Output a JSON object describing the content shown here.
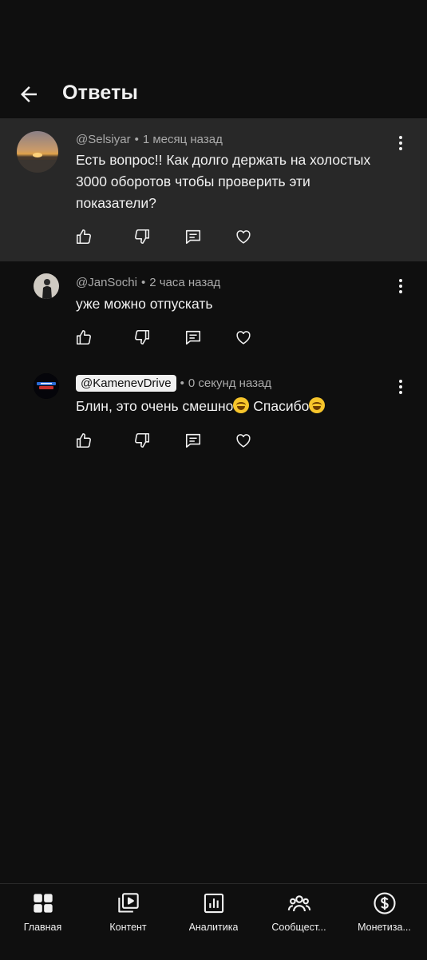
{
  "header": {
    "title": "Ответы"
  },
  "comments": [
    {
      "author": "@Selsiyar",
      "time": "1 месяц назад",
      "text_lines": [
        "Есть вопрос!! Как долго держать на холостых",
        "3000 оборотов чтобы проверить эти",
        "показатели?"
      ],
      "highlighted": true
    },
    {
      "author": "@JanSochi",
      "time": "2 часа назад",
      "text_lines": [
        "уже можно отпускать"
      ]
    },
    {
      "author": "@KamenevDrive",
      "time": "0 секунд назад",
      "text_before": "Блин, это очень смешно",
      "text_middle": " Спасибо",
      "emoji": "face-with-tears-of-joy"
    }
  ],
  "separator": "•",
  "bottom_nav": [
    {
      "label": "Главная",
      "icon": "dashboard-icon"
    },
    {
      "label": "Контент",
      "icon": "video-library-icon"
    },
    {
      "label": "Аналитика",
      "icon": "analytics-icon"
    },
    {
      "label": "Сообщест...",
      "icon": "community-icon"
    },
    {
      "label": "Монетиза...",
      "icon": "dollar-icon"
    }
  ],
  "colors": {
    "background": "#0f0f0f",
    "highlight": "#282828",
    "text": "#f1f1f1",
    "meta": "#aaaaaa"
  }
}
